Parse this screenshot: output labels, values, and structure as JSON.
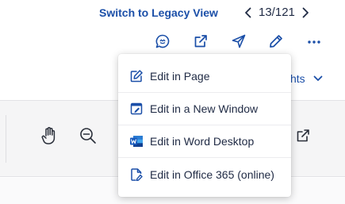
{
  "header": {
    "legacy_link": "Switch to Legacy View",
    "pager": {
      "current_of_total": "13/121"
    }
  },
  "action_icons": [
    "comment-icon",
    "share-external-icon",
    "send-icon",
    "edit-pencil-icon",
    "more-horizontal-icon"
  ],
  "background_dropdown": {
    "partial_label": "hts"
  },
  "toolbar_icons": [
    "hand-pan-icon",
    "zoom-out-icon",
    "open-external-icon"
  ],
  "edit_menu": {
    "items": [
      {
        "label": "Edit in Page",
        "icon": "edit-square-icon"
      },
      {
        "label": "Edit in a New Window",
        "icon": "new-window-edit-icon"
      },
      {
        "label": "Edit in Word Desktop",
        "icon": "word-icon"
      },
      {
        "label": "Edit in Office 365 (online)",
        "icon": "office-online-edit-icon"
      }
    ]
  },
  "colors": {
    "accent": "#1b4fa8",
    "text": "#1f2a44",
    "word_blue": "#2b579a"
  }
}
